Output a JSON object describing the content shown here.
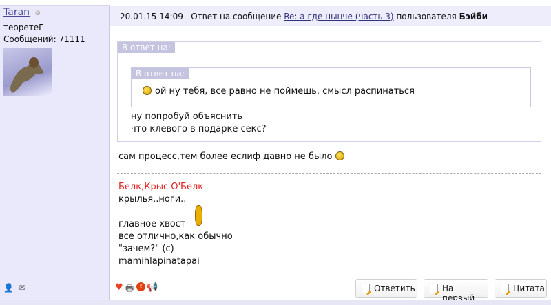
{
  "user": {
    "name": "Taran",
    "title": "теоретеГ",
    "posts": "Сообщений: 71111",
    "add_friend_icon": "user-add-icon",
    "message_icon": "mail-icon"
  },
  "header": {
    "datetime": "20.01.15 14:09",
    "reply_to_text": "Ответ на сообщение",
    "topic_link": "Re: а где нынче (часть 3)",
    "by_text": "пользователя",
    "author": "Бэйби"
  },
  "quote": {
    "label": "В ответ на:",
    "inner_label": "В ответ на:",
    "inner_text": "ой ну тебя, все равно не поймешь. смысл распинаться",
    "lines": [
      "ну попробуй объяснить",
      "что клевого в подарке секс?"
    ]
  },
  "message": {
    "text": "сам процесс,тем более еслиф давно не было"
  },
  "signature": {
    "red_line": "Белк,Крыс О'Белк",
    "lines": [
      "крылья..ноги..",
      "",
      "главное хвост",
      "все отлично,как обычно",
      "\"зачем?\" (с)",
      "mamihlapinatapai"
    ]
  },
  "actions": {
    "reply": "Ответить",
    "to_first": "На первый",
    "quote": "Цитата"
  }
}
